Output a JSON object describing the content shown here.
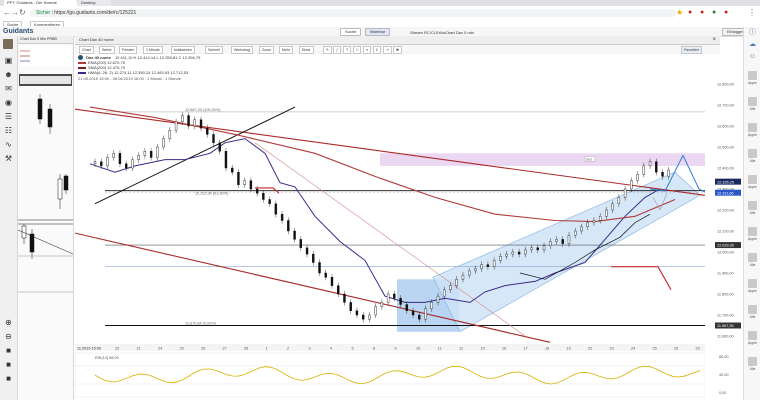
{
  "browser": {
    "tabs": [
      {
        "label": "PPT: Guidants - Der Normal"
      },
      {
        "label": "Desktop"
      }
    ],
    "secure_label": "Sicher",
    "url": "https://go.guidants.com/de#c/125221"
  },
  "bookmarks": [
    {
      "label": "Suche"
    },
    {
      "label": "Kommentieren"
    }
  ],
  "app": {
    "logo": "Guidants",
    "header_tabs": [
      {
        "label": "Suche"
      },
      {
        "label": "Warnbar"
      }
    ],
    "sub_tabs": [
      {
        "label": "Stream RC/CI-Erlös"
      },
      {
        "label": "Chart Dax 5 min"
      }
    ],
    "user_button": "Einloggen"
  },
  "panels": {
    "small_title": "Chart Dax 5 Min PRBB",
    "main_title": "Chart Dax 40 nome"
  },
  "toolbar": {
    "items": [
      "Chart",
      "Werte",
      "Fenster",
      "1 Minute",
      "Indikatoren",
      "Schnell",
      "Werkzeug",
      "Zoom",
      "Mehr",
      "Einst."
    ],
    "right_button": "Favoriten"
  },
  "legend": {
    "instrument": "Dax 40 nome",
    "ohlc": "12.411,10  H 12.414,14  L 12.259,81  C 12.394,79",
    "rows": [
      {
        "label": "EMA(200)  12.670,70",
        "color": "#b23a3a"
      },
      {
        "label": "SMA(200)  12.475,79",
        "color": "#7a1e1e"
      },
      {
        "label": "HMA(6, 26, 2)  12.274,11  12.350,24  12.483,93  12.712,53",
        "color": "#3b2a8a"
      }
    ],
    "range": "21.06.2019 15:00 - 28.06.2019 16:00 : 1 Monat : 1 Stunde"
  },
  "price_axis": {
    "labels": [
      "12.800,00",
      "12.700,00",
      "12.600,00",
      "12.500,00",
      "12.400,00",
      "12.300,00",
      "12.200,00",
      "12.100,00",
      "12.000,00",
      "11.900,00",
      "11.800,00",
      "11.700,00",
      "11.600,00"
    ],
    "current_price": "12.335,25",
    "current_color": "#1a2a5e",
    "blue_tag": "12.311,66",
    "blue_tag_color": "#2b58c9",
    "level_tags": [
      "12.033,30",
      "11.567,35"
    ],
    "indicator_axis": [
      "80,00",
      "40,00",
      "0,00"
    ]
  },
  "time_axis": {
    "labels": [
      "20",
      "21",
      "24",
      "25",
      "26",
      "27",
      "28",
      "1",
      "2",
      "3",
      "4",
      "5",
      "8",
      "9",
      "10",
      "11",
      "12",
      "15",
      "16",
      "17",
      "18",
      "19",
      "22",
      "23",
      "24",
      "25",
      "26",
      "29"
    ],
    "start_tag": "11.2019 15:00"
  },
  "annotations": {
    "top_fib": "12.667,20 (100,00%)",
    "mid_fib": "12.292,90 (61,80%)",
    "low_fib": "11.670,84 (0,00%)",
    "box_tag": "Sell"
  },
  "indicator_panel": {
    "label": "RSI(14)  58,09"
  },
  "right_sidebar": {
    "items": [
      "Apple",
      "Alle",
      "Apple",
      "Alle",
      "Apple",
      "Alle",
      "Apple",
      "Alle",
      "Apple",
      "Alle",
      "Apple",
      "Alle"
    ]
  }
}
